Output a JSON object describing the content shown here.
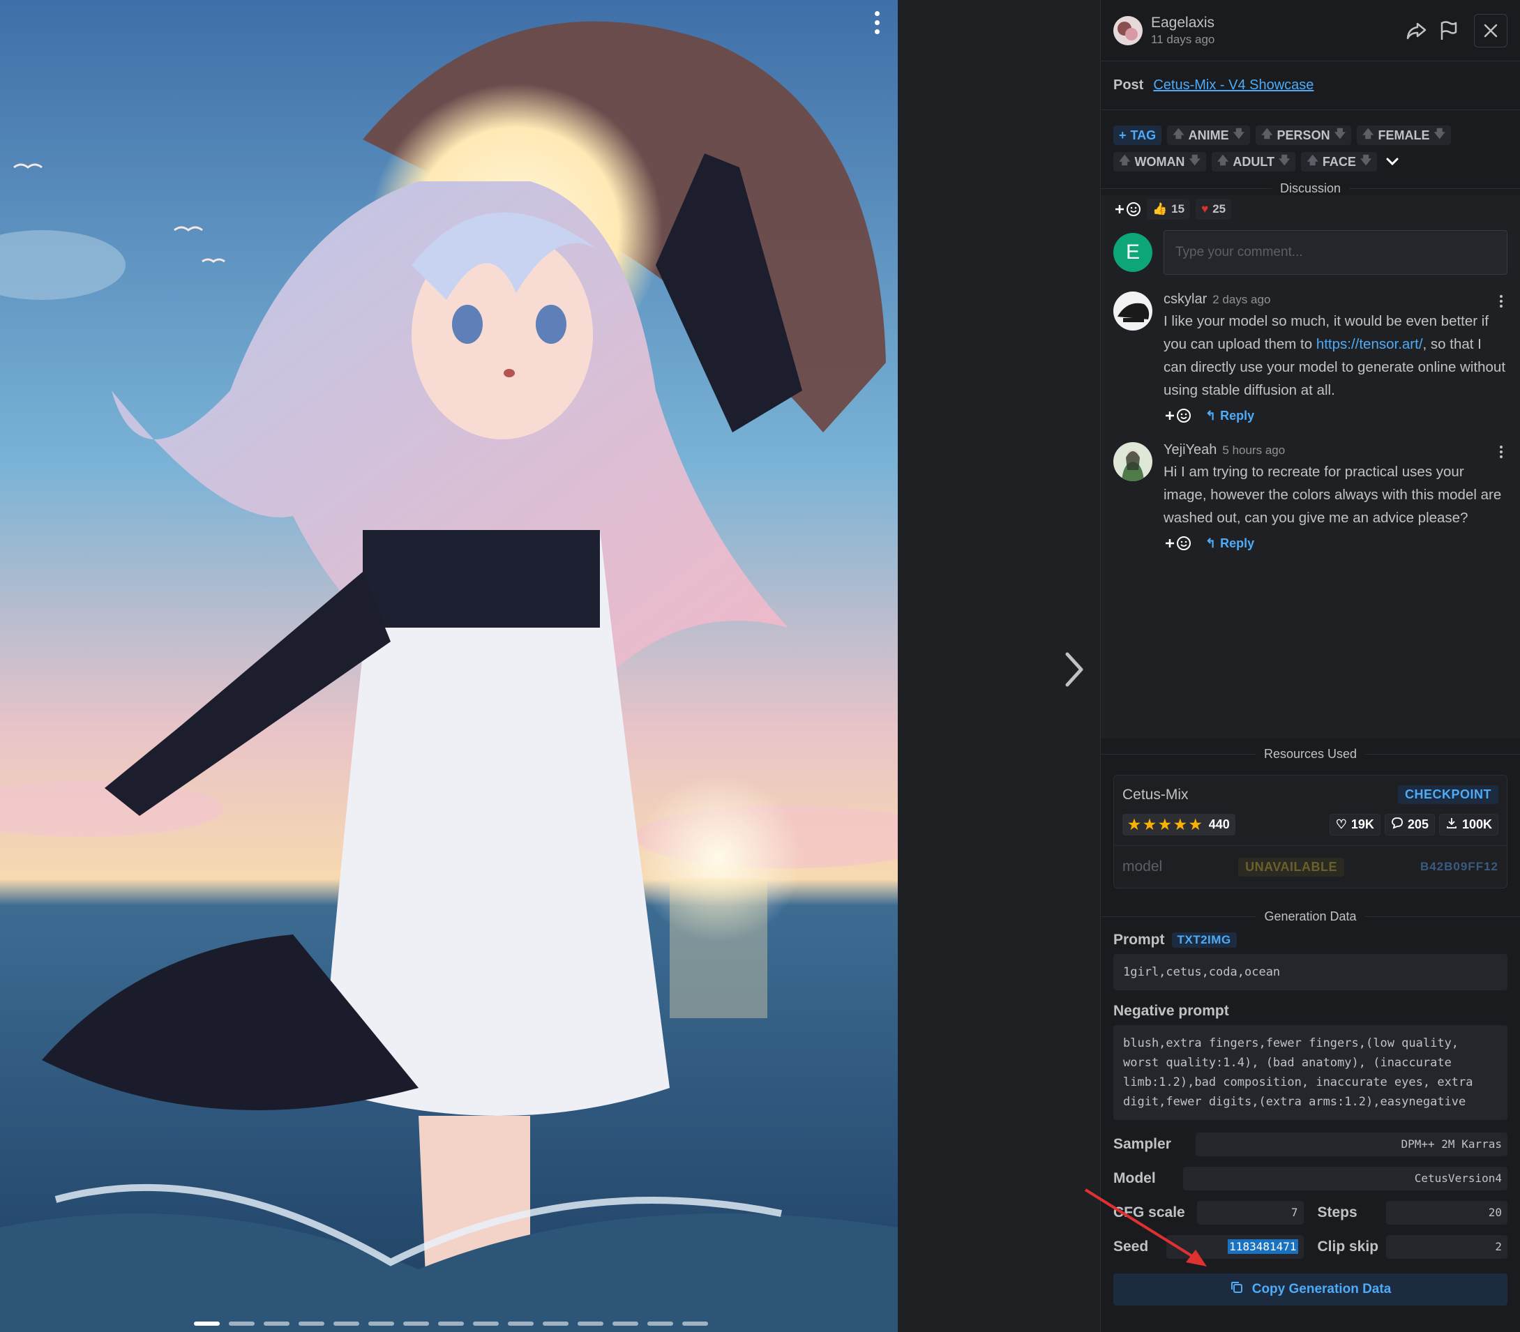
{
  "header": {
    "username": "Eagelaxis",
    "time": "11 days ago"
  },
  "post": {
    "label": "Post",
    "title": "Cetus-Mix - V4 Showcase"
  },
  "tags": {
    "add_label": "TAG",
    "items": [
      "ANIME",
      "PERSON",
      "FEMALE",
      "WOMAN",
      "ADULT",
      "FACE"
    ]
  },
  "discussion": {
    "heading": "Discussion",
    "reactions": [
      {
        "icon": "thumbs-up-icon",
        "count": "15"
      },
      {
        "icon": "heart-icon",
        "count": "25"
      }
    ],
    "composer": {
      "avatar_letter": "E",
      "placeholder": "Type your comment..."
    },
    "comments": [
      {
        "user": "cskylar",
        "time": "2 days ago",
        "text_before": "I like your model so much, it would be even better if you can upload them to ",
        "link": "https://tensor.art/",
        "text_after": ", so that I can directly use your model to generate online without using stable diffusion at all.",
        "reply_label": "Reply"
      },
      {
        "user": "YejiYeah",
        "time": "5 hours ago",
        "text_before": "Hi I am trying to recreate for practical uses your image, however the colors always with this model are washed out, can you give me an advice please?",
        "link": "",
        "text_after": "",
        "reply_label": "Reply"
      }
    ]
  },
  "resources": {
    "heading": "Resources Used",
    "name": "Cetus-Mix",
    "type_badge": "CHECKPOINT",
    "rating_count": "440",
    "rating_stars": 5,
    "likes": "19K",
    "comments": "205",
    "downloads": "100K",
    "kind": "model",
    "status": "UNAVAILABLE",
    "hash": "B42B09FF12"
  },
  "generation": {
    "heading": "Generation Data",
    "prompt_label": "Prompt",
    "prompt_badge": "TXT2IMG",
    "prompt": "1girl,cetus,coda,ocean",
    "negative_label": "Negative prompt",
    "negative": "blush,extra fingers,fewer fingers,(low quality, worst quality:1.4), (bad anatomy), (inaccurate limb:1.2),bad composition, inaccurate eyes, extra digit,fewer digits,(extra arms:1.2),easynegative",
    "sampler_label": "Sampler",
    "sampler": "DPM++ 2M Karras",
    "model_label": "Model",
    "model": "CetusVersion4",
    "cfg_label": "CFG scale",
    "cfg": "7",
    "steps_label": "Steps",
    "steps": "20",
    "seed_label": "Seed",
    "seed": "1183481471",
    "clip_label": "Clip skip",
    "clip": "2",
    "copy_label": "Copy Generation Data"
  },
  "colors": {
    "accent": "#4dabf7",
    "panel_bg": "#1a1b1e",
    "annotation_arrow": "#e03131"
  },
  "gallery": {
    "image_count": 15,
    "active_index": 0
  }
}
